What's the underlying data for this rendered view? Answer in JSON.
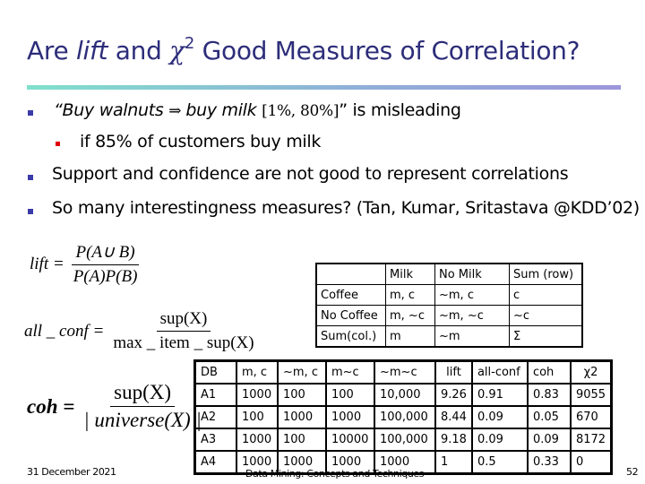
{
  "slide": {
    "title": {
      "part1": "Are ",
      "lift": "lift",
      "part2": " and ",
      "chi": "χ",
      "sup": "2",
      "part3": "  Good Measures of Correlation?"
    },
    "bullets": [
      {
        "quote_open": "“Buy walnuts ",
        "arrow": " ⇒ ",
        "italic2": "buy milk ",
        "bracket": "[1%, 80%]",
        "rest": "”  is misleading"
      },
      {
        "text": "if 85% of customers buy milk"
      },
      {
        "text": "Support and confidence are not good to represent correlations"
      },
      {
        "text": "So many interestingness measures?  (Tan, Kumar, Sritastava @KDD’02)"
      }
    ],
    "formulas": {
      "lift": {
        "lhs": "lift =",
        "num": "P(A∪ B)",
        "den": "P(A)P(B)"
      },
      "all_conf": {
        "lhs": "all _ conf =",
        "num": "sup(X)",
        "den": "max _ item _ sup(X)"
      },
      "coh": {
        "lhs": "coh =",
        "num": "sup(X)",
        "den": "| universe(X) |"
      }
    },
    "contingency_table": {
      "headers": [
        "",
        "Milk",
        "No Milk",
        "Sum (row)"
      ],
      "rows": [
        [
          "Coffee",
          "m, c",
          "~m, c",
          "c"
        ],
        [
          "No Coffee",
          "m, ~c",
          "~m, ~c",
          "~c"
        ],
        [
          "Sum(col.)",
          "m",
          "~m",
          "Σ"
        ]
      ]
    },
    "datasets_table": {
      "headers": [
        "DB",
        "m, c",
        "~m, c",
        "m~c",
        "~m~c",
        "lift",
        "all-conf",
        "coh",
        "χ2"
      ],
      "rows": [
        [
          "A1",
          "1000",
          "100",
          "100",
          "10,000",
          "9.26",
          "0.91",
          "0.83",
          "9055"
        ],
        [
          "A2",
          "100",
          "1000",
          "1000",
          "100,000",
          "8.44",
          "0.09",
          "0.05",
          "670"
        ],
        [
          "A3",
          "1000",
          "100",
          "10000",
          "100,000",
          "9.18",
          "0.09",
          "0.09",
          "8172"
        ],
        [
          "A4",
          "1000",
          "1000",
          "1000",
          "1000",
          "1",
          "0.5",
          "0.33",
          "0"
        ]
      ]
    },
    "footer": {
      "date": "31 December 2021",
      "center": "Data Mining: Concepts and Techniques",
      "page": "52"
    },
    "colors": {
      "title": "#2d2d7a",
      "bullet_primary": "#3a3aa8",
      "bullet_secondary": "#e00000"
    }
  }
}
